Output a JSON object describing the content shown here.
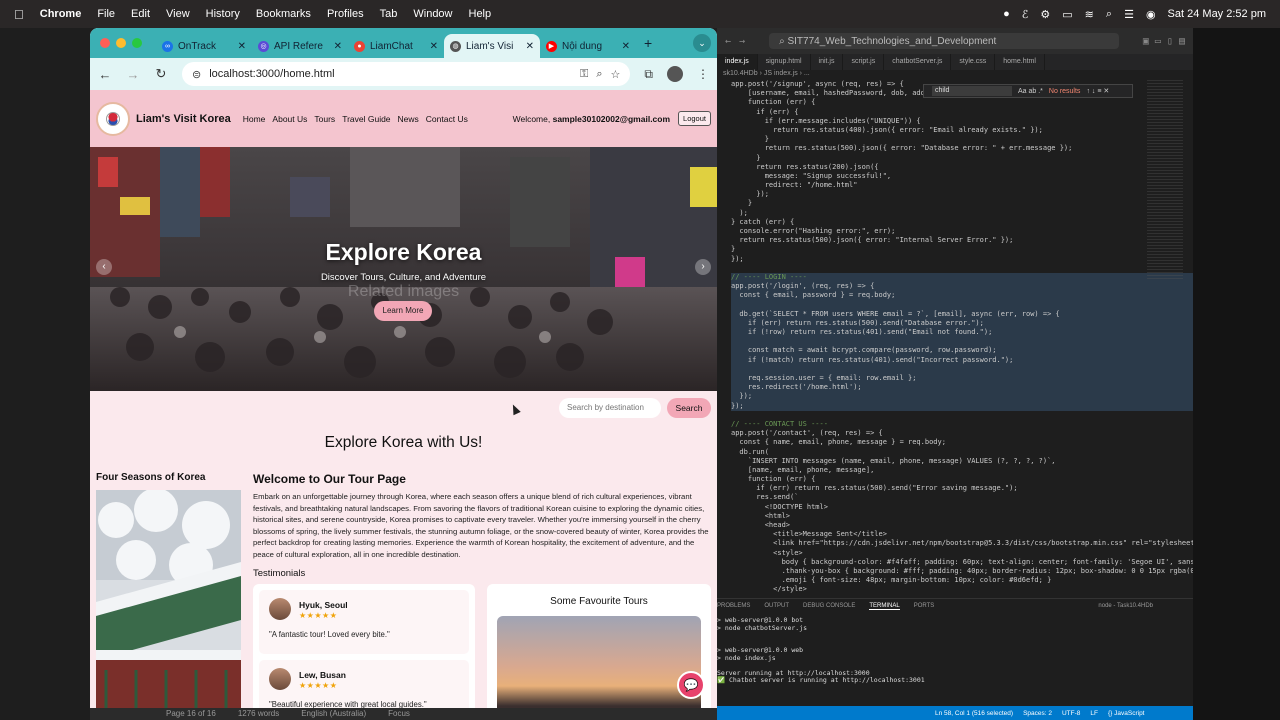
{
  "menubar": {
    "app": "Chrome",
    "items": [
      "File",
      "Edit",
      "View",
      "History",
      "Bookmarks",
      "Profiles",
      "Tab",
      "Window",
      "Help"
    ],
    "datetime": "Sat 24 May  2:52 pm"
  },
  "browser": {
    "tabs": [
      {
        "title": "OnTrack",
        "favicon_color": "#1a73e8"
      },
      {
        "title": "API Refere",
        "favicon_color": "#5b4bd6"
      },
      {
        "title": "LiamChat",
        "favicon_color": "#ea4335"
      },
      {
        "title": "Liam's Visi",
        "favicon_color": "#555555"
      },
      {
        "title": "Nội dung",
        "favicon_color": "#ff0000"
      }
    ],
    "url": "localhost:3000/home.html"
  },
  "site": {
    "brand": "Liam's Visit Korea",
    "nav": [
      "Home",
      "About Us",
      "Tours",
      "Travel Guide",
      "News",
      "Contact Us"
    ],
    "welcome_prefix": "Welcome, ",
    "user_email": "sample30102002@gmail.com",
    "logout_label": "Logout",
    "hero": {
      "title": "Explore Korea",
      "subtitle": "Discover Tours, Culture, and Adventure",
      "button": "Learn More",
      "ghost_text": "Related images"
    },
    "search": {
      "placeholder": "Search by destination",
      "button": "Search"
    },
    "section_title": "Explore Korea with Us!",
    "seasons_heading": "Four Seasons of Korea",
    "welcome_heading": "Welcome to Our Tour Page",
    "welcome_paragraph": "Embark on an unforgettable journey through Korea, where each season offers a unique blend of rich cultural experiences, vibrant festivals, and breathtaking natural landscapes. From savoring the flavors of traditional Korean cuisine to exploring the dynamic cities, historical sites, and serene countryside, Korea promises to captivate every traveler. Whether you're immersing yourself in the cherry blossoms of spring, the lively summer festivals, the stunning autumn foliage, or the snow-covered beauty of winter, Korea provides the perfect backdrop for creating lasting memories. Experience the warmth of Korean hospitality, the excitement of adventure, and the peace of cultural exploration, all in one incredible destination.",
    "testimonials_heading": "Testimonials",
    "testimonials": [
      {
        "name": "Hyuk, Seoul",
        "stars": "★★★★★",
        "quote": "\"A fantastic tour! Loved every bite.\""
      },
      {
        "name": "Lew, Busan",
        "stars": "★★★★★",
        "quote": "\"Beautiful experience with great local guides.\""
      }
    ],
    "favourite_heading": "Some Favourite Tours"
  },
  "vscode": {
    "search": "SIT774_Web_Technologies_and_Development",
    "tabs": [
      "index.js",
      "signup.html",
      "init.js",
      "script.js",
      "chatbotServer.js",
      "style.css",
      "home.html"
    ],
    "breadcrumb": "sk10.4HDb › JS index.js › ...",
    "find_value": "child",
    "find_result": "No results",
    "code": [
      "app.post('/signup', async (req, res) => {",
      "    [username, email, hashedPassword, dob, address, phone],",
      "    function (err) {",
      "      if (err) {",
      "        if (err.message.includes(\"UNIQUE\")) {",
      "          return res.status(400).json({ error: \"Email already exists.\" });",
      "        }",
      "        return res.status(500).json({ error: \"Database error: \" + err.message });",
      "      }",
      "      return res.status(200).json({",
      "        message: \"Signup successful!\",",
      "        redirect: \"/home.html\"",
      "      });",
      "    }",
      "  );",
      "} catch (err) {",
      "  console.error(\"Hashing error:\", err);",
      "  return res.status(500).json({ error: \"Internal Server Error.\" });",
      "}",
      "});",
      "",
      "// ---- LOGIN ----",
      "app.post('/login', (req, res) => {",
      "  const { email, password } = req.body;",
      "",
      "  db.get(`SELECT * FROM users WHERE email = ?`, [email], async (err, row) => {",
      "    if (err) return res.status(500).send(\"Database error.\");",
      "    if (!row) return res.status(401).send(\"Email not found.\");",
      "",
      "    const match = await bcrypt.compare(password, row.password);",
      "    if (!match) return res.status(401).send(\"Incorrect password.\");",
      "",
      "    req.session.user = { email: row.email };",
      "    res.redirect('/home.html');",
      "  });",
      "});",
      "",
      "// ---- CONTACT US ----",
      "app.post('/contact', (req, res) => {",
      "  const { name, email, phone, message } = req.body;",
      "  db.run(",
      "    `INSERT INTO messages (name, email, phone, message) VALUES (?, ?, ?, ?)`,",
      "    [name, email, phone, message],",
      "    function (err) {",
      "      if (err) return res.status(500).send(\"Error saving message.\");",
      "      res.send(`",
      "        <!DOCTYPE html>",
      "        <html>",
      "        <head>",
      "          <title>Message Sent</title>",
      "          <link href=\"https://cdn.jsdelivr.net/npm/bootstrap@5.3.3/dist/css/bootstrap.min.css\" rel=\"stylesheet\">",
      "          <style>",
      "            body { background-color: #f4faff; padding: 60px; text-align: center; font-family: 'Segoe UI', sans",
      "            .thank-you-box { background: #fff; padding: 40px; border-radius: 12px; box-shadow: 0 0 15px rgba(0",
      "            .emoji { font-size: 48px; margin-bottom: 10px; color: #0d6efd; }",
      "          </style>"
    ],
    "terminal_tabs": [
      "PROBLEMS",
      "OUTPUT",
      "DEBUG CONSOLE",
      "TERMINAL",
      "PORTS"
    ],
    "terminal_node": "node - Task10.4HDb",
    "terminal": [
      "> web-server@1.0.0 bot",
      "> node chatbotServer.js",
      "",
      "",
      "> web-server@1.0.0 web",
      "> node index.js",
      "",
      "Server running at http://localhost:3000",
      "✅ Chatbot server is running at http://localhost:3001"
    ],
    "status": [
      "Ln 58, Col 1 (516 selected)",
      "Spaces: 2",
      "UTF-8",
      "LF",
      "{} JavaScript"
    ]
  },
  "dock_hint": [
    "Page 16 of 16",
    "1276 words",
    "English (Australia)",
    "Focus"
  ]
}
